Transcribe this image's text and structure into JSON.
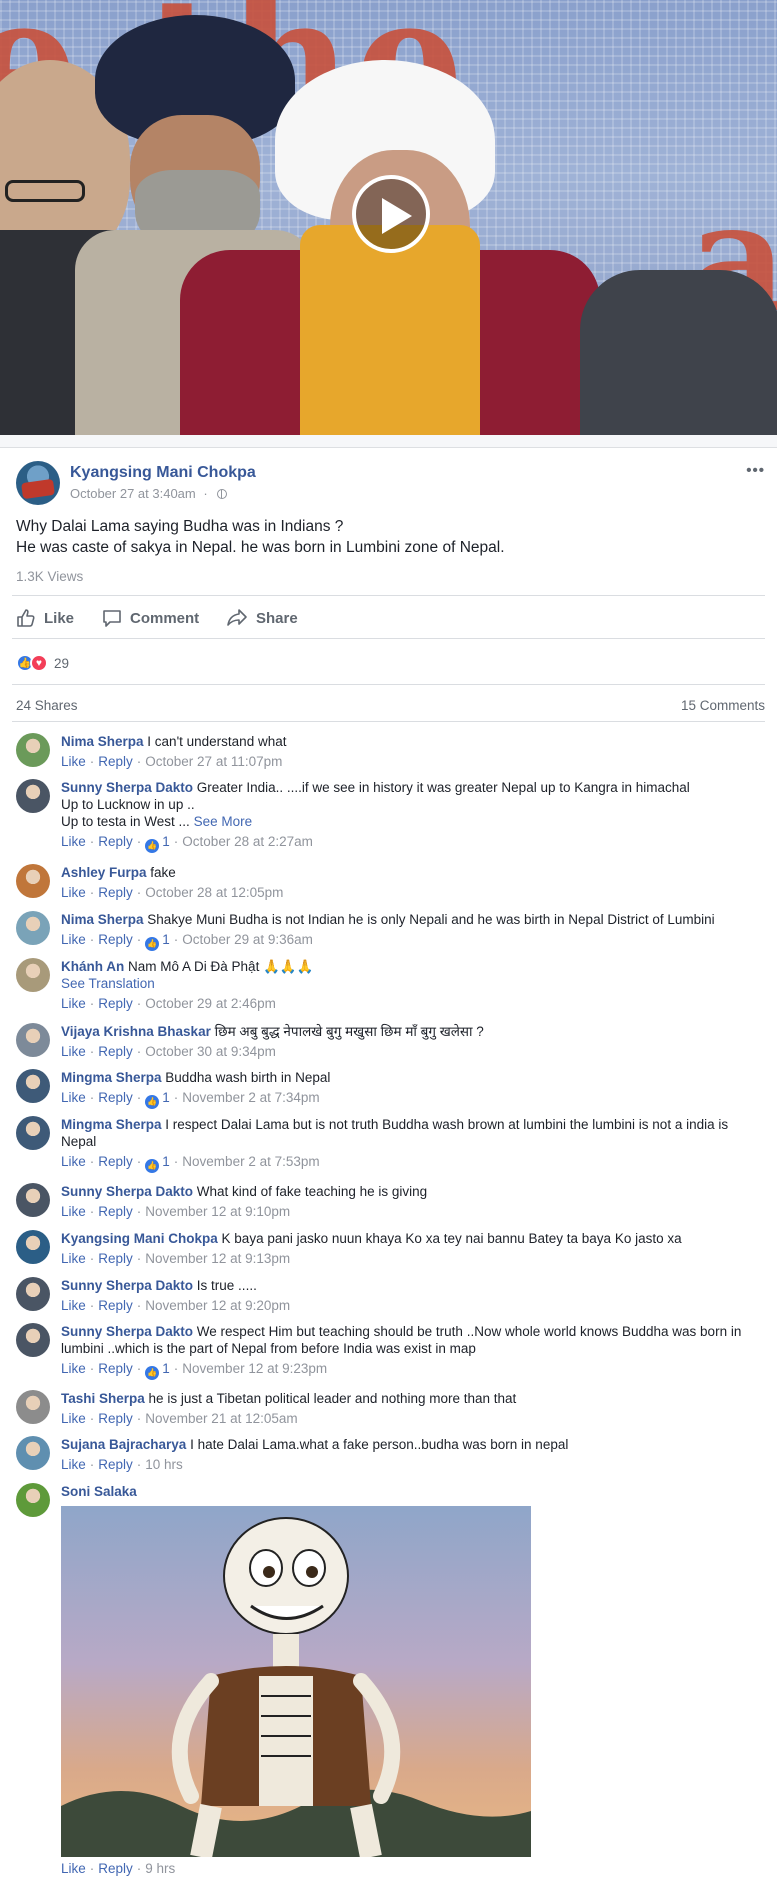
{
  "video": {
    "background_text": [
      "e the",
      "a"
    ],
    "play_icon": "play-icon"
  },
  "post": {
    "author": "Kyangsing Mani Chokpa",
    "time": "October 27 at 3:40am",
    "more": "•••",
    "text_line1": "Why Dalai Lama saying Budha was in Indians ?",
    "text_line2": "He was caste of sakya in Nepal. he was born in Lumbini zone of Nepal.",
    "views": "1.3K Views",
    "actions": {
      "like": "Like",
      "comment": "Comment",
      "share": "Share"
    },
    "reaction_count": "29",
    "shares": "24 Shares",
    "comments_count": "15 Comments"
  },
  "labels": {
    "like": "Like",
    "reply": "Reply",
    "see_more": "See More",
    "see_translation": "See Translation"
  },
  "comments": [
    {
      "name": "Nima Sherpa",
      "text": "I can't understand what",
      "time": "October 27 at 11:07pm",
      "likes": "",
      "avatar": "#6b9a5a"
    },
    {
      "name": "Sunny Sherpa Dakto",
      "text": "Greater India.. ....if we see in history it was greater Nepal up to Kangra in himachal",
      "text2": "Up to Lucknow in up ..",
      "text3": "Up to testa in West ...",
      "time": "October 28 at 2:27am",
      "likes": "1",
      "avatar": "#4a5564"
    },
    {
      "name": "Ashley Furpa",
      "text": "fake",
      "time": "October 28 at 12:05pm",
      "likes": "",
      "avatar": "#c0763a"
    },
    {
      "name": "Nima Sherpa",
      "text": "Shakye Muni Budha is not Indian he is only Nepali and he was birth in Nepal District of Lumbini",
      "time": "October 29 at 9:36am",
      "likes": "1",
      "avatar": "#7aa3b8"
    },
    {
      "name": "Khánh An",
      "text": "Nam Mô A Di Đà Phật",
      "emoji": "🙏🙏🙏",
      "time": "October 29 at 2:46pm",
      "likes": "",
      "avatar": "#a89a7a"
    },
    {
      "name": "Vijaya Krishna Bhaskar",
      "text": "छिम अबु बुद्ध नेपालखे बुगु मखुसा छिम माँ बुगु खलेसा ?",
      "time": "October 30 at 9:34pm",
      "likes": "",
      "avatar": "#7d8a99"
    },
    {
      "name": "Mingma Sherpa",
      "text": "Buddha wash birth in Nepal",
      "time": "November 2 at 7:34pm",
      "likes": "1",
      "avatar": "#3e5a78"
    },
    {
      "name": "Mingma Sherpa",
      "text": "I respect Dalai Lama but is not truth Buddha wash brown at lumbini the lumbini is not a india is",
      "text2": "Nepal",
      "time": "November 2 at 7:53pm",
      "likes": "1",
      "avatar": "#3e5a78"
    },
    {
      "name": "Sunny Sherpa Dakto",
      "text": "What kind of fake teaching he is giving",
      "time": "November 12 at 9:10pm",
      "likes": "",
      "avatar": "#4a5564"
    },
    {
      "name": "Kyangsing Mani Chokpa",
      "text": "K baya pani jasko nuun khaya Ko xa tey nai bannu Batey ta baya Ko jasto xa",
      "time": "November 12 at 9:13pm",
      "likes": "",
      "avatar": "#2b5e86"
    },
    {
      "name": "Sunny Sherpa Dakto",
      "text": "Is true .....",
      "time": "November 12 at 9:20pm",
      "likes": "",
      "avatar": "#4a5564"
    },
    {
      "name": "Sunny Sherpa Dakto",
      "text": "We respect Him but teaching should be truth ..Now whole world knows Buddha was born in",
      "text2": "lumbini ..which is the part of Nepal from before India was exist in map",
      "time": "November 12 at 9:23pm",
      "likes": "1",
      "avatar": "#4a5564"
    },
    {
      "name": "Tashi Sherpa",
      "text": "he is just a Tibetan political leader and nothing more than that",
      "time": "November 21 at 12:05am",
      "likes": "",
      "avatar": "#8c8c8c"
    },
    {
      "name": "Sujana Bajracharya",
      "text": "I hate Dalai Lama.what a fake person..budha was born in nepal",
      "time": "10 hrs",
      "likes": "",
      "avatar": "#5f8fb0"
    },
    {
      "name": "Soni Salaka",
      "text": "",
      "time": "9 hrs",
      "likes": "",
      "avatar": "#5e9a3a"
    }
  ],
  "colors": {
    "link": "#385898",
    "meta": "#90949c",
    "like_blue": "#3578e5",
    "love_red": "#f33e58"
  }
}
